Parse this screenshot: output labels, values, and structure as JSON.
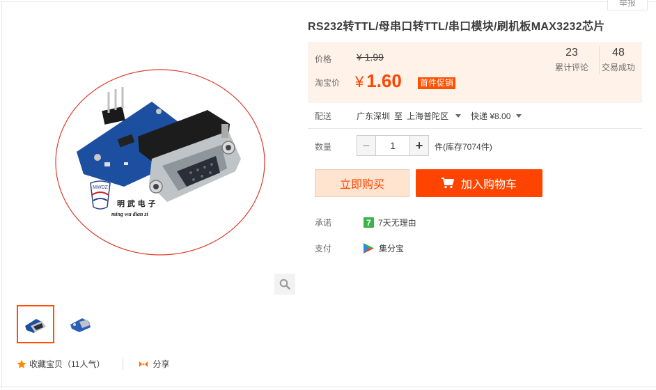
{
  "report_label": "举报",
  "product": {
    "title": "RS232转TTL/母串口转TTL/串口模块/刷机板MAX3232芯片",
    "image_logo_text": "明 武 电 子",
    "image_logo_pinyin": "ming   wu   dian   zi",
    "image_logo_mark": "MWDZ"
  },
  "price": {
    "label": "价格",
    "original": "¥ 1.99",
    "sale_label": "淘宝价",
    "sale_currency": "¥",
    "sale_value": "1.60",
    "promo_badge": "首件促销"
  },
  "stats": {
    "reviews_value": "23",
    "reviews_label": "累计评论",
    "sales_value": "48",
    "sales_label": "交易成功"
  },
  "shipping": {
    "label": "配送",
    "from": "广东深圳",
    "to_word": "至",
    "destination": "上海普陀区",
    "fee": "快递 ¥8.00"
  },
  "quantity": {
    "label": "数量",
    "value": "1",
    "minus": "−",
    "plus": "+",
    "stock": "件(库存7074件)"
  },
  "actions": {
    "buy_now": "立即购买",
    "add_to_cart": "加入购物车"
  },
  "promise": {
    "label": "承诺",
    "icon_glyph": "7",
    "text": "7天无理由"
  },
  "payment": {
    "label": "支付",
    "text": "集分宝"
  },
  "social": {
    "favorite": "收藏宝贝（11人气）",
    "share": "分享"
  },
  "colors": {
    "accent": "#ff4400",
    "price_bg": "#fff2e8",
    "buy_bg": "#ffe4d0",
    "promise_green": "#3cb34a"
  },
  "icons": [
    "search-icon",
    "cart-icon",
    "star-icon",
    "share-icon",
    "promise-7-icon",
    "jifenbao-icon",
    "caret-down-icon"
  ]
}
